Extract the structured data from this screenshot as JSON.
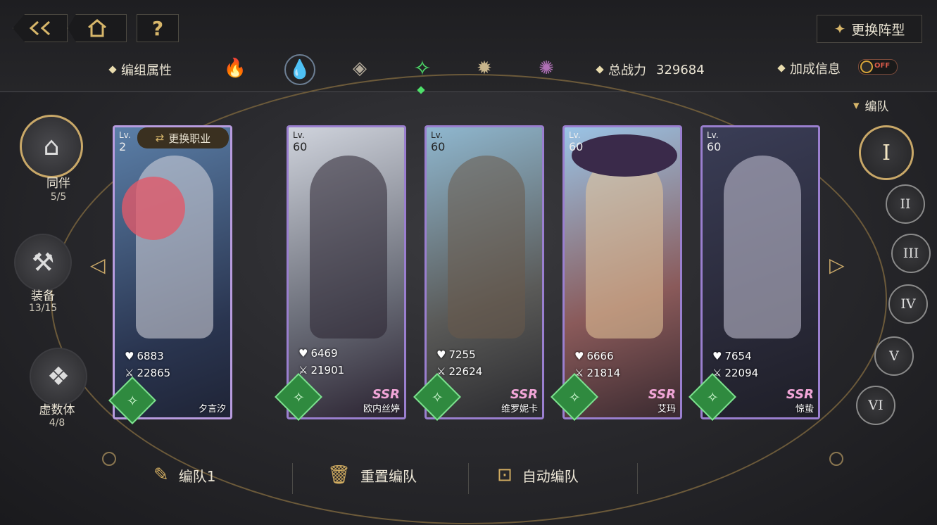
{
  "header": {
    "back_icon": "back-arrow-icon",
    "home_icon": "home-icon",
    "help_label": "?",
    "formation_label": "更换阵型",
    "attr_label": "编组属性",
    "power_label": "总战力",
    "power_value": "329684",
    "bonus_label": "加成信息",
    "bonus_toggle": "OFF"
  },
  "elements": [
    {
      "icon": "fire-icon",
      "color": "#c97d6e",
      "selected": false
    },
    {
      "icon": "water-icon",
      "color": "#9fb6d0",
      "selected": false
    },
    {
      "icon": "earth-icon",
      "color": "#b3aa9a",
      "selected": false
    },
    {
      "icon": "wind-icon",
      "color": "#4ee06a",
      "selected": true
    },
    {
      "icon": "light-icon",
      "color": "#c8b58c",
      "selected": false
    },
    {
      "icon": "dark-icon",
      "color": "#b070b6",
      "selected": false
    }
  ],
  "left_nav": [
    {
      "label": "同伴",
      "count": "5/5",
      "icon": "companion-icon",
      "active": true
    },
    {
      "label": "装备",
      "count": "13/15",
      "icon": "equipment-icon",
      "active": false
    },
    {
      "label": "虚数体",
      "count": "4/8",
      "icon": "imaginary-icon",
      "active": false
    }
  ],
  "team_label": "编队",
  "team_numbers": [
    "I",
    "II",
    "III",
    "IV",
    "V",
    "VI"
  ],
  "cards": [
    {
      "lv_label": "Lv.",
      "lv": "2",
      "hp": "6883",
      "atk": "22865",
      "name": "夕言汐",
      "rarity": "",
      "change_job": "更换职业",
      "palette": [
        "#5b7fa8",
        "#d8d8e0"
      ]
    },
    {
      "lv_label": "Lv.",
      "lv": "60",
      "hp": "6469",
      "atk": "21901",
      "name": "欧内丝婷",
      "rarity": "SSR",
      "change_job": "",
      "palette": [
        "#cfd3dc",
        "#2a2230"
      ]
    },
    {
      "lv_label": "Lv.",
      "lv": "60",
      "hp": "7255",
      "atk": "22624",
      "name": "维罗妮卡",
      "rarity": "SSR",
      "change_job": "",
      "palette": [
        "#8fb7cf",
        "#6a5a4a"
      ]
    },
    {
      "lv_label": "Lv.",
      "lv": "60",
      "hp": "6666",
      "atk": "21814",
      "name": "艾玛",
      "rarity": "SSR",
      "change_job": "",
      "palette": [
        "#9ac4e6",
        "#e8c89a"
      ]
    },
    {
      "lv_label": "Lv.",
      "lv": "60",
      "hp": "7654",
      "atk": "22094",
      "name": "惊蛰",
      "rarity": "SSR",
      "change_job": "",
      "palette": [
        "#3a3d56",
        "#c9c6d8"
      ]
    }
  ],
  "footer": {
    "team_name": "编队1",
    "reset_label": "重置编队",
    "auto_label": "自动编队"
  },
  "colors": {
    "accent_gold": "#c9a868",
    "wind_green": "#4ee06a"
  }
}
